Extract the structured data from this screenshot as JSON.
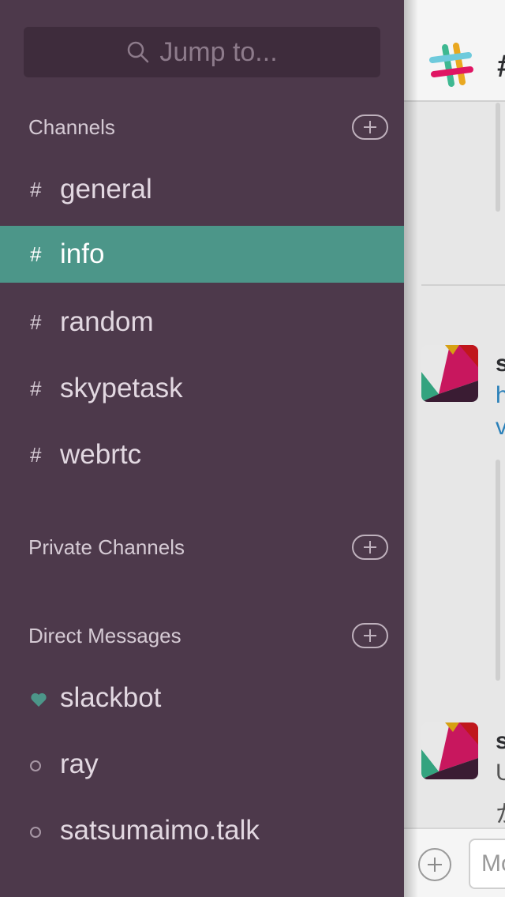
{
  "search": {
    "placeholder": "Jump to..."
  },
  "sections": {
    "channels": {
      "label": "Channels"
    },
    "private_channels": {
      "label": "Private Channels"
    },
    "direct_messages": {
      "label": "Direct Messages"
    }
  },
  "channels": [
    {
      "prefix": "#",
      "name": "general",
      "active": false
    },
    {
      "prefix": "#",
      "name": "info",
      "active": true
    },
    {
      "prefix": "#",
      "name": "random",
      "active": false
    },
    {
      "prefix": "#",
      "name": "skypetask",
      "active": false
    },
    {
      "prefix": "#",
      "name": "webrtc",
      "active": false
    }
  ],
  "direct_messages": [
    {
      "name": "slackbot",
      "presence": "heart-icon"
    },
    {
      "name": "ray",
      "presence": "away-dot-icon"
    },
    {
      "name": "satsumaimo.talk",
      "presence": "away-dot-icon"
    }
  ],
  "main": {
    "channel_prefix": "#",
    "messages": [
      {
        "author_fragment": "s",
        "line1": "h",
        "line2": "v"
      },
      {
        "author_fragment": "s",
        "line1": "U",
        "line2": "か"
      }
    ],
    "composer_placeholder": "Mo"
  },
  "colors": {
    "sidebar_bg": "#4d394b",
    "active_row": "#4c9689",
    "link": "#2a80b9"
  }
}
